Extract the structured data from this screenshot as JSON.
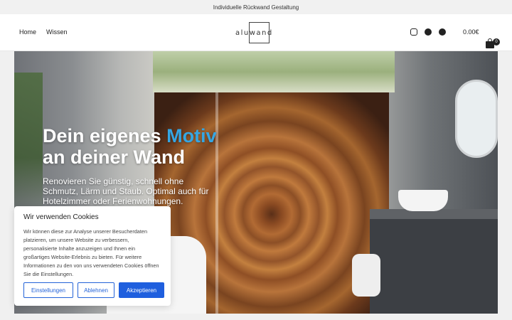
{
  "topbar": {
    "text": "Individuelle Rückwand Gestaltung"
  },
  "header": {
    "nav": [
      {
        "label": "Home"
      },
      {
        "label": "Wissen"
      }
    ],
    "logo_text": "aluwand",
    "social": [
      "instagram-icon",
      "facebook-icon",
      "pinterest-icon"
    ],
    "cart_total": "0.00€",
    "cart_count": "0"
  },
  "hero": {
    "title_line1_prefix": "Dein eigenes ",
    "title_line1_accent": "Motiv",
    "title_line2": "an deiner Wand",
    "subtitle": "Renovieren Sie günstig, schnell ohne Schmutz, Lärm und Staub. Optimal auch für Hotelzimmer oder Ferienwohnungen."
  },
  "cookie": {
    "title": "Wir verwenden Cookies",
    "text": "Wir können diese zur Analyse unserer Besucherdaten platzieren, um unsere Website zu verbessern, personalisierte Inhalte anzuzeigen und Ihnen ein großartiges Website-Erlebnis zu bieten. Für weitere Informationen zu den von uns verwendeten Cookies öffnen Sie die Einstellungen.",
    "buttons": {
      "settings": "Einstellungen",
      "decline": "Ablehnen",
      "accept": "Akzeptieren"
    }
  },
  "colors": {
    "accent": "#35a6e3",
    "button_blue": "#1f5fde"
  }
}
